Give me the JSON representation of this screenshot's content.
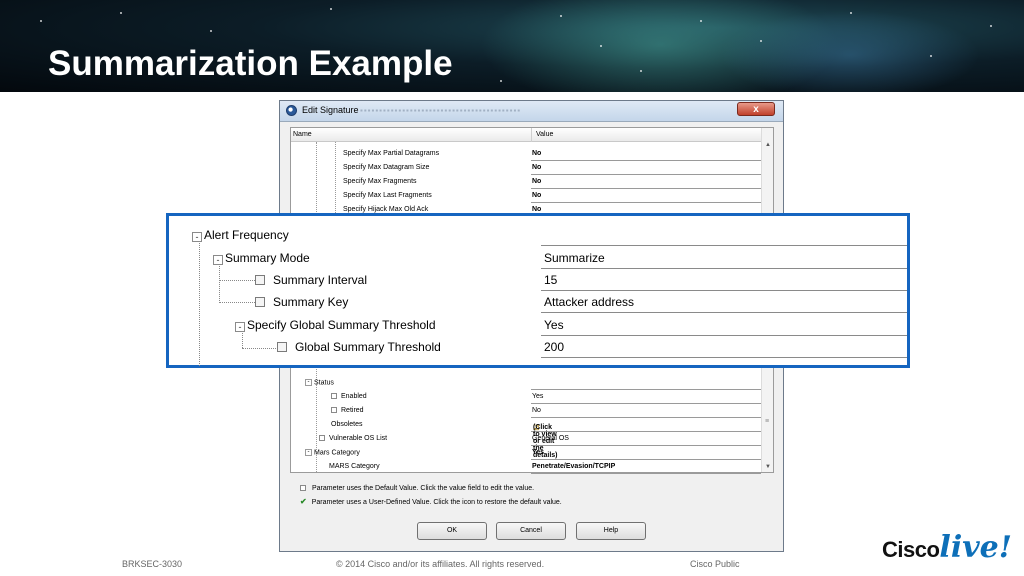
{
  "slide": {
    "title": "Summarization Example",
    "footer_left": "BRKSEC-3030",
    "footer_center": "© 2014 Cisco and/or its affiliates. All rights reserved.",
    "footer_right": "Cisco Public",
    "logo_word": "Cisco",
    "logo_script": "live!"
  },
  "dialog": {
    "title": "Edit Signature",
    "close_label": "x",
    "columns": {
      "name": "Name",
      "value": "Value"
    },
    "rows": [
      {
        "name": "Specify Max Partial Datagrams",
        "value": "No"
      },
      {
        "name": "Specify Max Datagram Size",
        "value": "No"
      },
      {
        "name": "Specify Max Fragments",
        "value": "No"
      },
      {
        "name": "Specify Max Last Fragments",
        "value": "No"
      },
      {
        "name": "Specify Hijack Max Old Ack",
        "value": "No"
      }
    ],
    "lower_rows": [
      {
        "name": "Status",
        "value": ""
      },
      {
        "name": "Enabled",
        "value": "Yes"
      },
      {
        "name": "Retired",
        "value": "No"
      },
      {
        "name": "Obsoletes",
        "value": "(Click to view or edit the details)"
      },
      {
        "name": "Vulnerable OS List",
        "value": "General OS"
      },
      {
        "name": "Mars Category",
        "value": "Yes"
      },
      {
        "name": "MARS Category",
        "value": "Penetrate/Evasion/TCPIP"
      }
    ],
    "legend_default": "Parameter uses the Default Value.  Click the value field to edit the value.",
    "legend_user": "Parameter uses a User-Defined Value.  Click the icon to restore the default value.",
    "buttons": {
      "ok": "OK",
      "cancel": "Cancel",
      "help": "Help"
    }
  },
  "zoom": {
    "rows": [
      {
        "name": "Alert Frequency",
        "value": ""
      },
      {
        "name": "Summary Mode",
        "value": "Summarize"
      },
      {
        "name": "Summary Interval",
        "value": "15"
      },
      {
        "name": "Summary Key",
        "value": "Attacker address"
      },
      {
        "name": "Specify Global Summary Threshold",
        "value": "Yes"
      },
      {
        "name": "Global Summary Threshold",
        "value": "200"
      }
    ]
  },
  "colors": {
    "callout_border": "#1565c0",
    "logo_accent": "#0d6fb8"
  }
}
